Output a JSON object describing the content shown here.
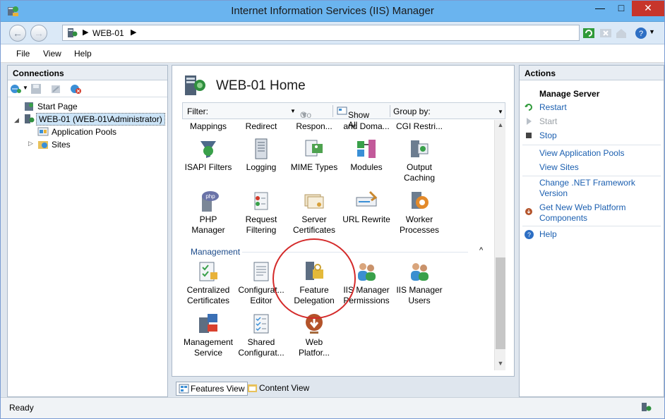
{
  "window": {
    "title": "Internet Information Services (IIS) Manager"
  },
  "address": {
    "crumb": "WEB-01"
  },
  "menu": {
    "file": "File",
    "view": "View",
    "help": "Help"
  },
  "connections": {
    "header": "Connections",
    "tree": {
      "start_page": "Start Page",
      "server": "WEB-01 (WEB-01\\Administrator)",
      "app_pools": "Application Pools",
      "sites": "Sites"
    }
  },
  "home": {
    "title": "WEB-01 Home",
    "filter_label": "Filter:",
    "go_label": "Go",
    "show_all_label": "Show All",
    "group_by_label": "Group by:",
    "cut_row": [
      "Mappings",
      "Redirect",
      "Respon...",
      "and Doma...",
      "CGI Restri..."
    ],
    "row1": [
      {
        "l1": "ISAPI Filters",
        "l2": "",
        "icon": "isapi-filters-icon"
      },
      {
        "l1": "Logging",
        "l2": "",
        "icon": "logging-icon"
      },
      {
        "l1": "MIME Types",
        "l2": "",
        "icon": "mime-types-icon"
      },
      {
        "l1": "Modules",
        "l2": "",
        "icon": "modules-icon"
      },
      {
        "l1": "Output",
        "l2": "Caching",
        "icon": "output-caching-icon"
      }
    ],
    "row2": [
      {
        "l1": "PHP",
        "l2": "Manager",
        "icon": "php-icon"
      },
      {
        "l1": "Request",
        "l2": "Filtering",
        "icon": "request-filtering-icon"
      },
      {
        "l1": "Server",
        "l2": "Certificates",
        "icon": "server-certificates-icon"
      },
      {
        "l1": "URL Rewrite",
        "l2": "",
        "icon": "url-rewrite-icon"
      },
      {
        "l1": "Worker",
        "l2": "Processes",
        "icon": "worker-processes-icon"
      }
    ],
    "management_header": "Management",
    "row3": [
      {
        "l1": "Centralized",
        "l2": "Certificates",
        "icon": "centralized-certificates-icon"
      },
      {
        "l1": "Configurat...",
        "l2": "Editor",
        "icon": "configuration-editor-icon"
      },
      {
        "l1": "Feature",
        "l2": "Delegation",
        "icon": "feature-delegation-icon"
      },
      {
        "l1": "IIS Manager",
        "l2": "Permissions",
        "icon": "iis-manager-permissions-icon"
      },
      {
        "l1": "IIS Manager",
        "l2": "Users",
        "icon": "iis-manager-users-icon"
      }
    ],
    "row4": [
      {
        "l1": "Management",
        "l2": "Service",
        "icon": "management-service-icon"
      },
      {
        "l1": "Shared",
        "l2": "Configurat...",
        "icon": "shared-configuration-icon"
      },
      {
        "l1": "Web",
        "l2": "Platfor...",
        "icon": "web-platform-icon"
      }
    ]
  },
  "view_tabs": {
    "features": "Features View",
    "content": "Content View"
  },
  "actions": {
    "header": "Actions",
    "group_title": "Manage Server",
    "restart": "Restart",
    "start": "Start",
    "stop": "Stop",
    "view_app_pools": "View Application Pools",
    "view_sites": "View Sites",
    "change_net_1": "Change .NET Framework",
    "change_net_2": "Version",
    "get_new_1": "Get New Web Platform",
    "get_new_2": "Components",
    "help": "Help"
  },
  "status": {
    "text": "Ready"
  }
}
